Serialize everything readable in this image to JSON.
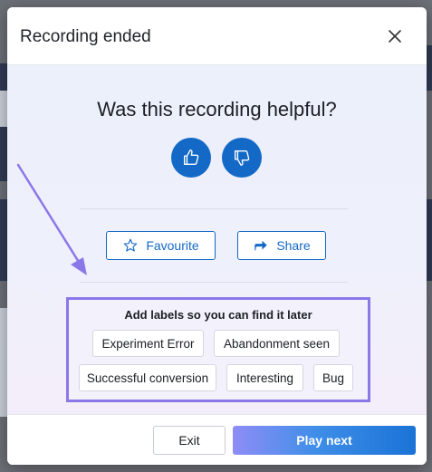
{
  "dialog": {
    "title": "Recording ended",
    "close_icon": "close-icon"
  },
  "feedback": {
    "question": "Was this recording helpful?",
    "thumbs_up_icon": "thumbs-up-icon",
    "thumbs_down_icon": "thumbs-down-icon"
  },
  "actions": {
    "favourite_label": "Favourite",
    "favourite_icon": "star-outline-icon",
    "share_label": "Share",
    "share_icon": "share-icon"
  },
  "labels": {
    "heading": "Add labels so you can find it later",
    "chips": [
      "Experiment Error",
      "Abandonment seen",
      "Successful conversion",
      "Interesting",
      "Bug"
    ]
  },
  "footer": {
    "exit_label": "Exit",
    "play_next_label": "Play next"
  },
  "colors": {
    "accent": "#1469c7",
    "highlight_border": "#8a78e8",
    "annotation_arrow": "#8a78e8"
  }
}
